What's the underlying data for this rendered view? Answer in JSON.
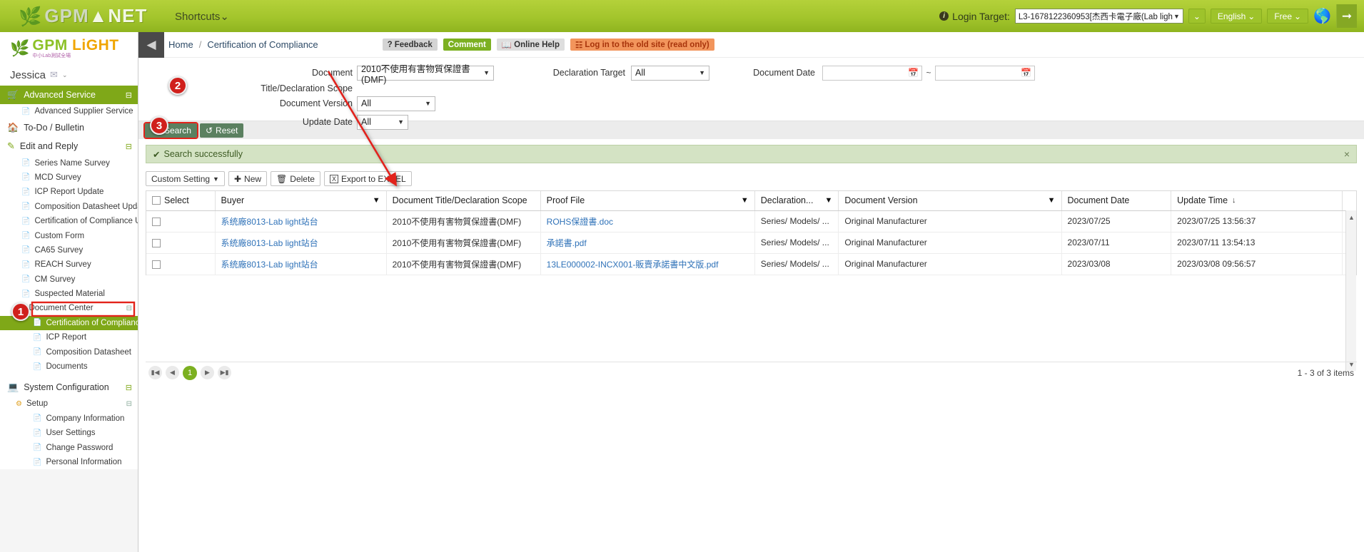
{
  "topbar": {
    "brand": "GPM",
    "brand_suffix": "NET",
    "shortcuts": "Shortcuts",
    "login_label": "Login Target:",
    "login_value": "L3-1678122360953[杰西卡電子廠(Lab ligh...",
    "lang": "English",
    "plan": "Free",
    "globe_icon": "globe-icon",
    "logout_icon": "logout-icon"
  },
  "sidebar": {
    "logo_main": "GPM",
    "logo_light": "LiGHT",
    "logo_sub": "中小Lab測試全場",
    "user": "Jessica",
    "groups": [
      {
        "label": "Advanced Service",
        "icon": "cart-icon",
        "style": "green",
        "items": [
          {
            "label": "Advanced Supplier Service"
          }
        ]
      },
      {
        "label": "To-Do / Bulletin",
        "icon": "home-icon",
        "style": "white",
        "items": []
      },
      {
        "label": "Edit and Reply",
        "icon": "pencil-icon",
        "style": "white",
        "items": [
          {
            "label": "Series Name Survey"
          },
          {
            "label": "MCD Survey"
          },
          {
            "label": "ICP Report Update"
          },
          {
            "label": "Composition Datasheet Update"
          },
          {
            "label": "Certification of Compliance Upd"
          },
          {
            "label": "Custom Form"
          },
          {
            "label": "CA65 Survey"
          },
          {
            "label": "REACH Survey"
          },
          {
            "label": "CM Survey"
          },
          {
            "label": "Suspected Material"
          }
        ]
      }
    ],
    "doc_center": {
      "label": "Document Center",
      "items": [
        {
          "label": "Certification of Compliance",
          "active": true
        },
        {
          "label": "ICP Report",
          "active": false
        },
        {
          "label": "Composition Datasheet",
          "active": false
        },
        {
          "label": "Documents",
          "active": false
        }
      ]
    },
    "system_config": {
      "label": "System Configuration",
      "setup_label": "Setup",
      "items": [
        {
          "label": "Company Information"
        },
        {
          "label": "User Settings"
        },
        {
          "label": "Change Password"
        },
        {
          "label": "Personal Information"
        }
      ]
    }
  },
  "breadcrumb": {
    "home": "Home",
    "sep": "/",
    "current": "Certification of Compliance",
    "feedback": "Feedback",
    "comment": "Comment",
    "online_help": "Online Help",
    "old_site": "Log in to the old site (read only)"
  },
  "search_form": {
    "doc_title_label_1": "Document",
    "doc_title_label_2": "Title/Declaration Scope",
    "doc_title_value": "2010不使用有害物質保證書(DMF)",
    "doc_version_label": "Document Version",
    "doc_version_value": "All",
    "update_date_label": "Update Date",
    "update_date_value": "All",
    "declaration_target_label": "Declaration Target",
    "declaration_target_value": "All",
    "document_date_label": "Document Date",
    "document_date_from": "",
    "document_date_to": "",
    "date_sep": "~",
    "search_btn": "Search",
    "reset_btn": "Reset"
  },
  "badges": {
    "b1": "1",
    "b2": "2",
    "b3": "3"
  },
  "alert": {
    "text": "Search successfully",
    "close": "×"
  },
  "toolbar": {
    "custom_setting": "Custom Setting",
    "new": "New",
    "delete": "Delete",
    "export": "Export to EXCEL"
  },
  "table": {
    "columns": [
      {
        "label": "Select",
        "filter": false
      },
      {
        "label": "Buyer",
        "filter": true
      },
      {
        "label": "Document Title/Declaration Scope",
        "filter": false
      },
      {
        "label": "Proof File",
        "filter": true
      },
      {
        "label": "Declaration...",
        "filter": true
      },
      {
        "label": "Document Version",
        "filter": true
      },
      {
        "label": "Document Date",
        "filter": false
      },
      {
        "label": "Update Time",
        "filter": false,
        "sorted": "desc"
      }
    ],
    "rows": [
      {
        "buyer": "系统廠8013-Lab light站台",
        "doc_title": "2010不使用有害物質保證書(DMF)",
        "proof_file": "ROHS保證書.doc",
        "declaration": "Series/ Models/ ...",
        "version": "Original Manufacturer",
        "doc_date": "2023/07/25",
        "update_time": "2023/07/25 13:56:37"
      },
      {
        "buyer": "系统廠8013-Lab light站台",
        "doc_title": "2010不使用有害物質保證書(DMF)",
        "proof_file": "承諾書.pdf",
        "declaration": "Series/ Models/ ...",
        "version": "Original Manufacturer",
        "doc_date": "2023/07/11",
        "update_time": "2023/07/11 13:54:13"
      },
      {
        "buyer": "系统廠8013-Lab light站台",
        "doc_title": "2010不使用有害物質保證書(DMF)",
        "proof_file": "13LE000002-INCX001-販賣承諾書中文版.pdf",
        "declaration": "Series/ Models/ ...",
        "version": "Original Manufacturer",
        "doc_date": "2023/03/08",
        "update_time": "2023/03/08 09:56:57"
      }
    ]
  },
  "pager": {
    "first": "|◀",
    "prev": "◀",
    "page": "1",
    "next": "▶",
    "last": "▶|",
    "info": "1 - 3 of 3 items"
  }
}
